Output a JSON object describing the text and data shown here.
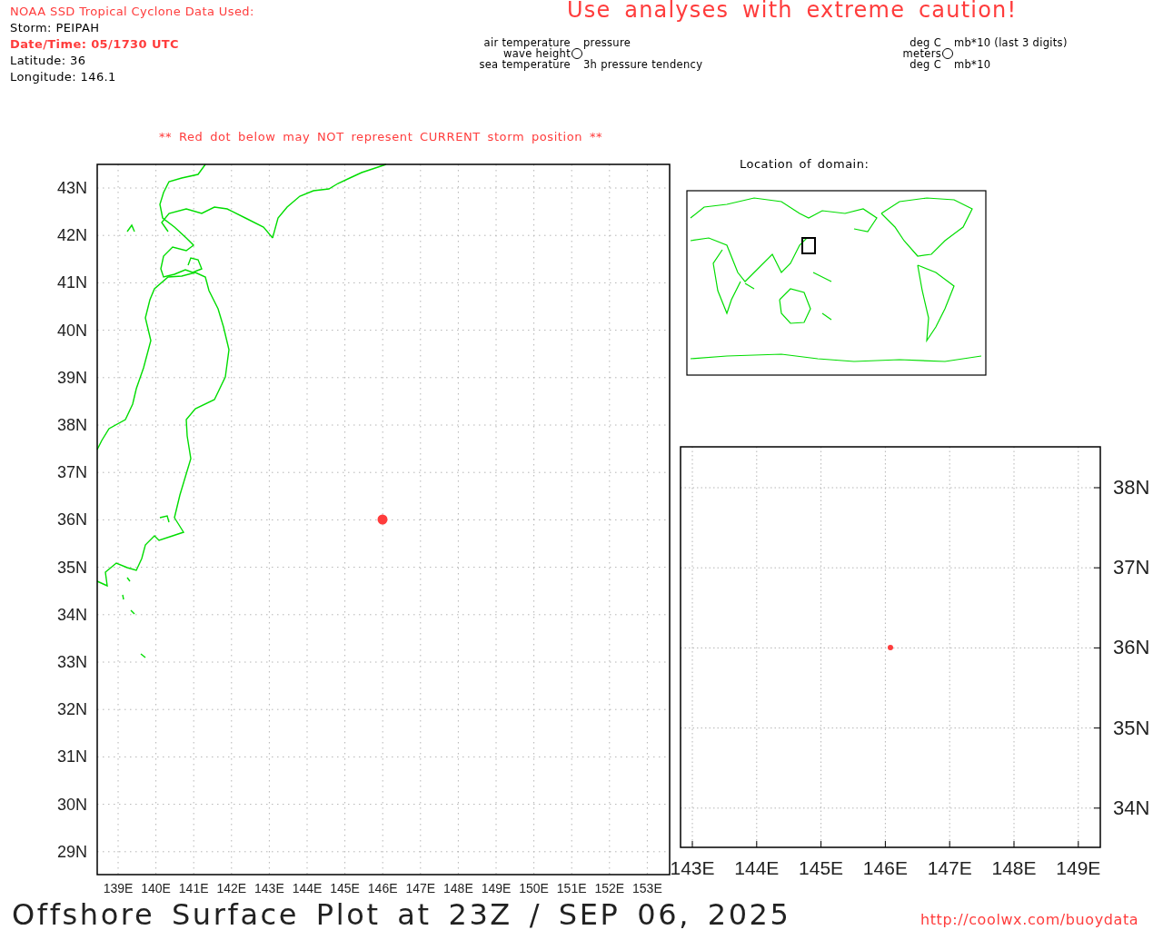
{
  "header": {
    "source": "NOAA SSD Tropical Cyclone Data Used:",
    "storm": "Storm: PEIPAH",
    "datetime": "Date/Time: 05/1730 UTC",
    "latitude": "Latitude: 36",
    "longitude": "Longitude: 146.1"
  },
  "caution": "Use analyses with extreme caution!",
  "legends": [
    {
      "left": {
        "top": "air temperature",
        "middle": "wave height",
        "bottom": "sea temperature"
      },
      "right": {
        "top": "pressure",
        "bottom": "3h pressure tendency"
      }
    },
    {
      "left": {
        "top": "deg C",
        "middle": "meters",
        "bottom": "deg C"
      },
      "right": {
        "top": "mb*10 (last 3 digits)",
        "bottom": "mb*10"
      }
    }
  ],
  "main_map": {
    "note": "** Red dot below may NOT represent CURRENT storm position **",
    "lat_labels": [
      "43N",
      "42N",
      "41N",
      "40N",
      "39N",
      "38N",
      "37N",
      "36N",
      "35N",
      "34N",
      "33N",
      "32N",
      "31N",
      "30N",
      "29N"
    ],
    "lon_labels": [
      "139E",
      "140E",
      "141E",
      "142E",
      "143E",
      "144E",
      "145E",
      "146E",
      "147E",
      "148E",
      "149E",
      "150E",
      "151E",
      "152E",
      "153E"
    ]
  },
  "domain_map": {
    "title": "Location of domain:"
  },
  "zoom_map": {
    "lat_labels": [
      "38N",
      "37N",
      "36N",
      "35N",
      "34N"
    ],
    "lon_labels": [
      "143E",
      "144E",
      "145E",
      "146E",
      "147E",
      "148E",
      "149E"
    ]
  },
  "footer": {
    "title": "Offshore Surface Plot at 23Z / SEP 06, 2025",
    "url": "http://coolwx.com/buoydata"
  }
}
